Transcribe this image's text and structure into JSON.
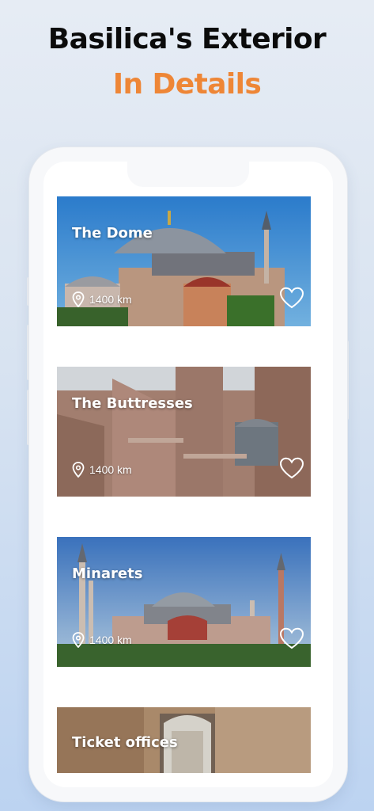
{
  "headline": {
    "line1": "Basilica's Exterior",
    "line2": "In Details"
  },
  "colors": {
    "accent": "#ee8636"
  },
  "cards": [
    {
      "title": "The Dome",
      "distance": "1400 km",
      "favorite_icon": "heart-outline-icon",
      "location_icon": "map-pin-icon"
    },
    {
      "title": "The Buttresses",
      "distance": "1400 km",
      "favorite_icon": "heart-outline-icon",
      "location_icon": "map-pin-icon"
    },
    {
      "title": "Minarets",
      "distance": "1400 km",
      "favorite_icon": "heart-outline-icon",
      "location_icon": "map-pin-icon"
    },
    {
      "title": "Ticket offices"
    }
  ]
}
